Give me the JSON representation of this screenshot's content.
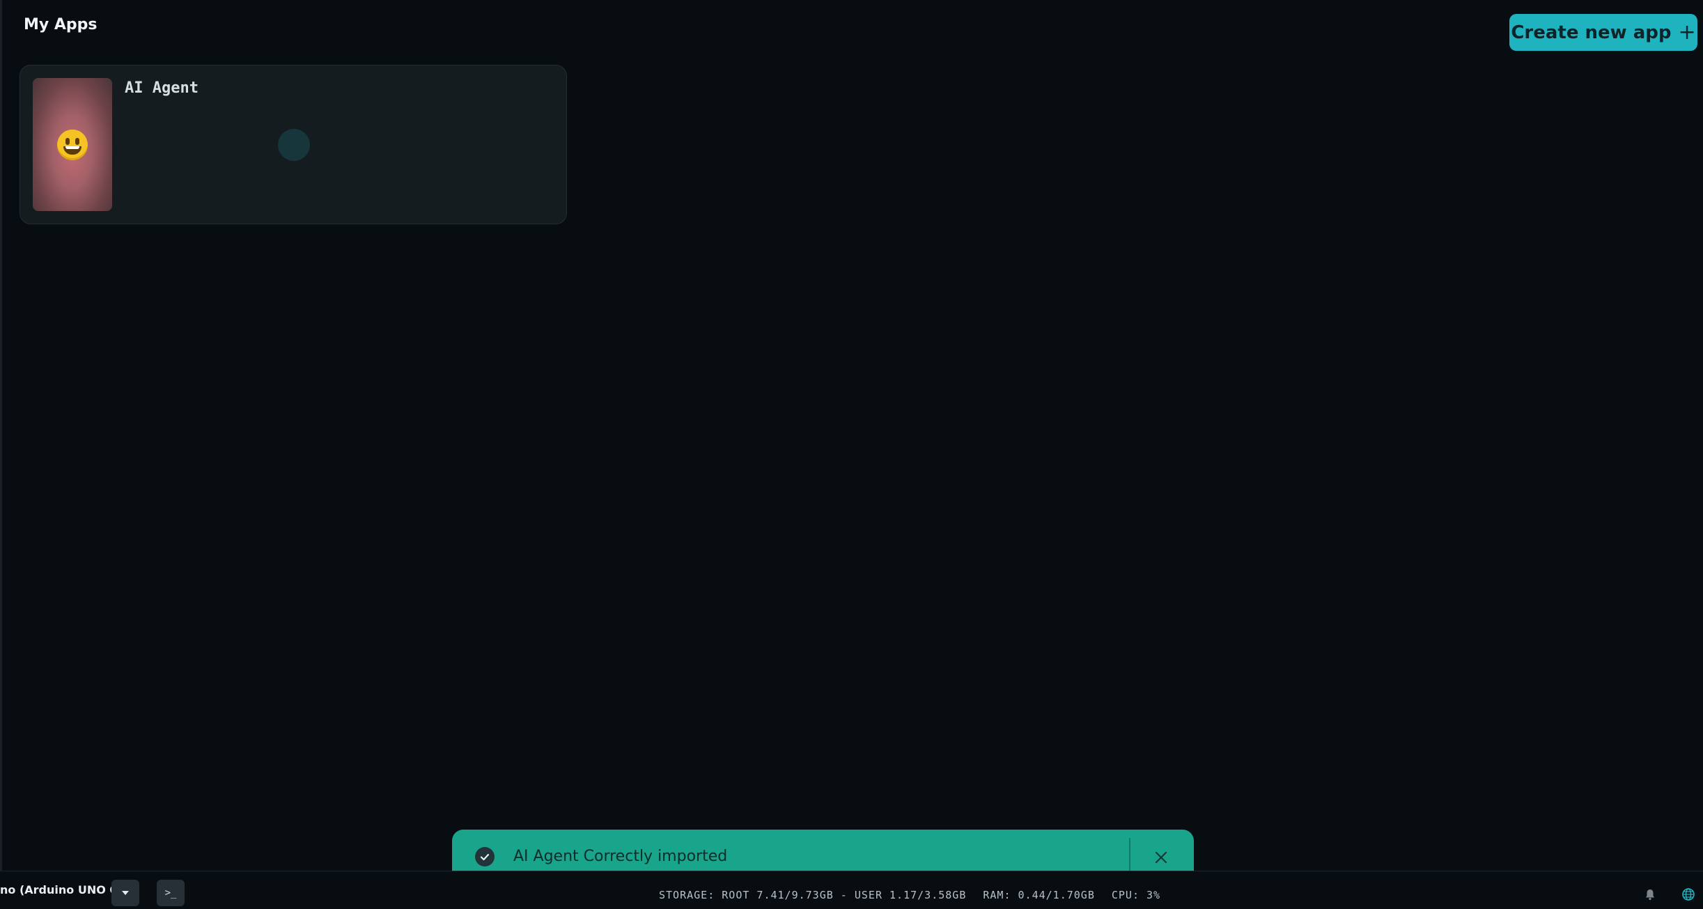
{
  "header": {
    "title": "My Apps",
    "create_button_label": "Create new app",
    "create_button_icon": "plus-icon"
  },
  "apps": [
    {
      "name": "AI Agent",
      "thumbnail_icon": "grinning-face-emoji",
      "status": "loading"
    }
  ],
  "toast": {
    "message": "AI Agent Correctly imported",
    "icon": "check-circle-icon",
    "color": "#19a58c"
  },
  "footer": {
    "board_name": "no (Arduino UNO Q)",
    "terminal_label": ">_",
    "storage": "STORAGE: ROOT 7.41/9.73GB - USER 1.17/3.58GB",
    "ram": "RAM: 0.44/1.70GB",
    "cpu": "CPU: 3%"
  },
  "colors": {
    "background": "#080d11",
    "accent": "#1eb3be"
  }
}
